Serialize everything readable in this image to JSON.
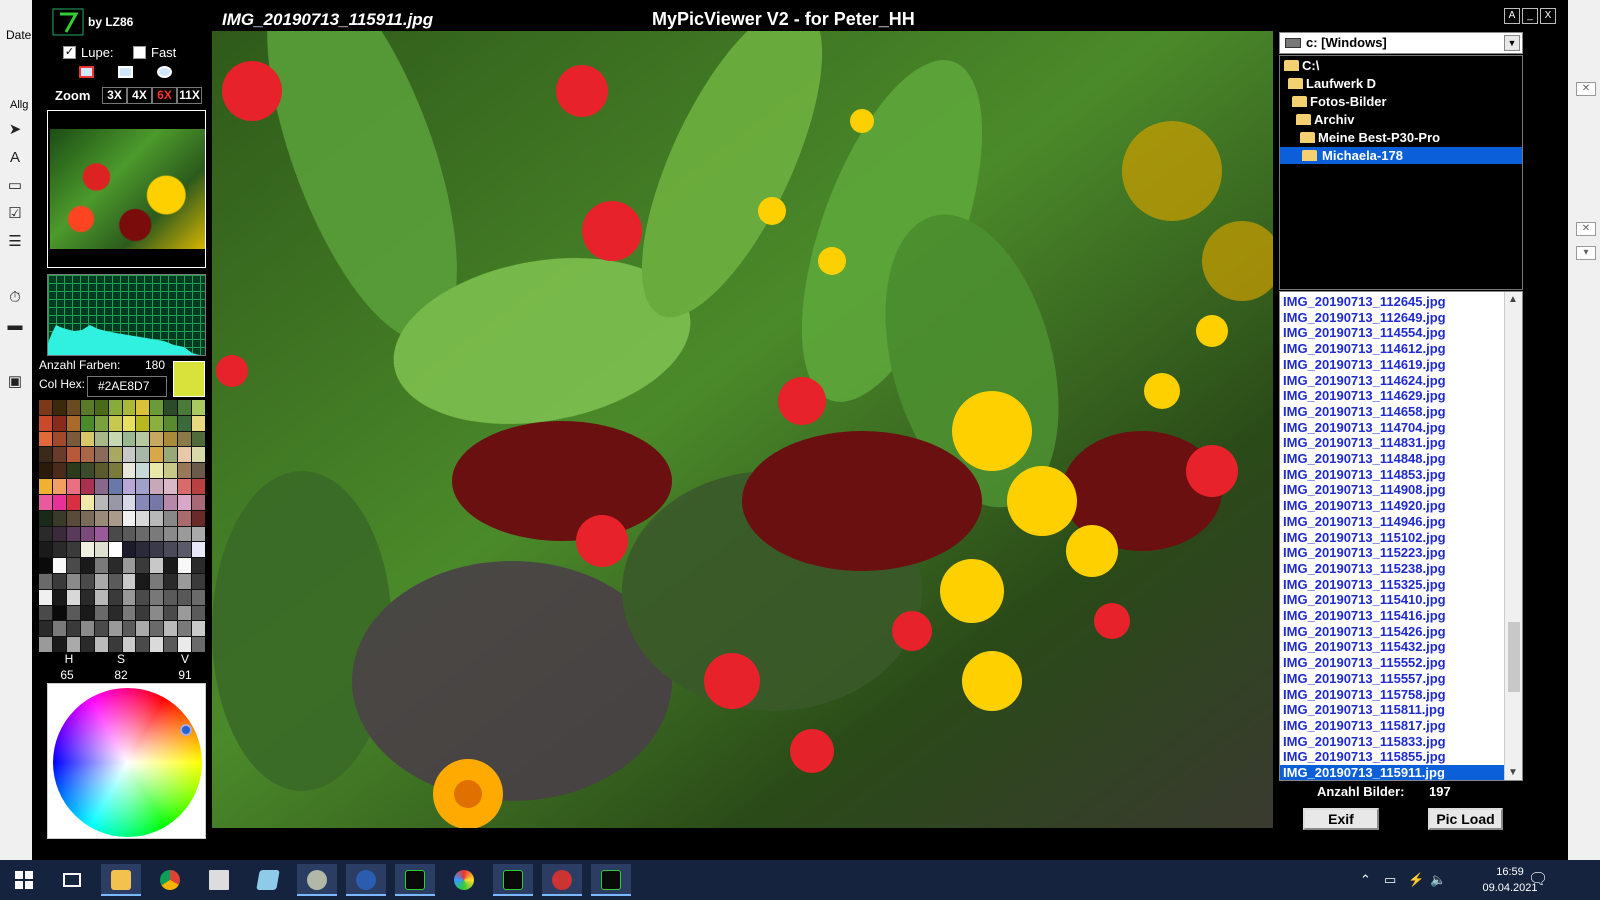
{
  "window": {
    "app_title": "MyPicViewer V2 - for Peter_HH",
    "image_name": "IMG_20190713_115911.jpg",
    "credit": "by LZ86",
    "buttons": [
      "A",
      "_",
      "X"
    ]
  },
  "background_app": {
    "menu": "Date",
    "tab": "Allg"
  },
  "loupe": {
    "lupe_label": "Lupe:",
    "lupe_checked": true,
    "fast_label": "Fast",
    "fast_checked": false
  },
  "zoom": {
    "label": "Zoom",
    "options": [
      "3X",
      "4X",
      "6X",
      "11X"
    ],
    "active": "6X"
  },
  "colors": {
    "count_label": "Anzahl Farben:",
    "count": "180",
    "hex_label": "Col Hex:",
    "hex_value": "#2AE8D7",
    "swatch_color": "#d8e23a",
    "accent_selection": "#0b5fd8",
    "file_text": "#1f2bd0"
  },
  "hsv": {
    "labels": [
      "H",
      "S",
      "V"
    ],
    "values": [
      "65",
      "82",
      "91"
    ]
  },
  "drive": {
    "selected": "c: [Windows]"
  },
  "tree": [
    {
      "label": "C:\\"
    },
    {
      "label": "Laufwerk  D"
    },
    {
      "label": "Fotos-Bilder"
    },
    {
      "label": "Archiv"
    },
    {
      "label": "Meine Best-P30-Pro"
    },
    {
      "label": "Michaela-178",
      "selected": true
    }
  ],
  "files": [
    "IMG_20190713_112645.jpg",
    "IMG_20190713_112649.jpg",
    "IMG_20190713_114554.jpg",
    "IMG_20190713_114612.jpg",
    "IMG_20190713_114619.jpg",
    "IMG_20190713_114624.jpg",
    "IMG_20190713_114629.jpg",
    "IMG_20190713_114658.jpg",
    "IMG_20190713_114704.jpg",
    "IMG_20190713_114831.jpg",
    "IMG_20190713_114848.jpg",
    "IMG_20190713_114853.jpg",
    "IMG_20190713_114908.jpg",
    "IMG_20190713_114920.jpg",
    "IMG_20190713_114946.jpg",
    "IMG_20190713_115102.jpg",
    "IMG_20190713_115223.jpg",
    "IMG_20190713_115238.jpg",
    "IMG_20190713_115325.jpg",
    "IMG_20190713_115410.jpg",
    "IMG_20190713_115416.jpg",
    "IMG_20190713_115426.jpg",
    "IMG_20190713_115432.jpg",
    "IMG_20190713_115552.jpg",
    "IMG_20190713_115557.jpg",
    "IMG_20190713_115758.jpg",
    "IMG_20190713_115811.jpg",
    "IMG_20190713_115817.jpg",
    "IMG_20190713_115833.jpg",
    "IMG_20190713_115855.jpg",
    "IMG_20190713_115911.jpg"
  ],
  "selected_file": "IMG_20190713_115911.jpg",
  "image_count_label": "Anzahl Bilder:",
  "image_count": "197",
  "actions": {
    "exif": "Exif",
    "pic_load": "Pic Load"
  },
  "taskbar": {
    "time": "16:59",
    "date": "09.04.2021",
    "apps": [
      "start-icon",
      "task-view-icon",
      "file-explorer-icon",
      "chrome-icon",
      "calculator-icon",
      "notepad-icon",
      "viewer-eye-icon",
      "app-icon",
      "mypicviewer-icon",
      "paint-icon",
      "mypicviewer-icon",
      "paint-tool-icon",
      "mypicviewer-icon"
    ]
  }
}
